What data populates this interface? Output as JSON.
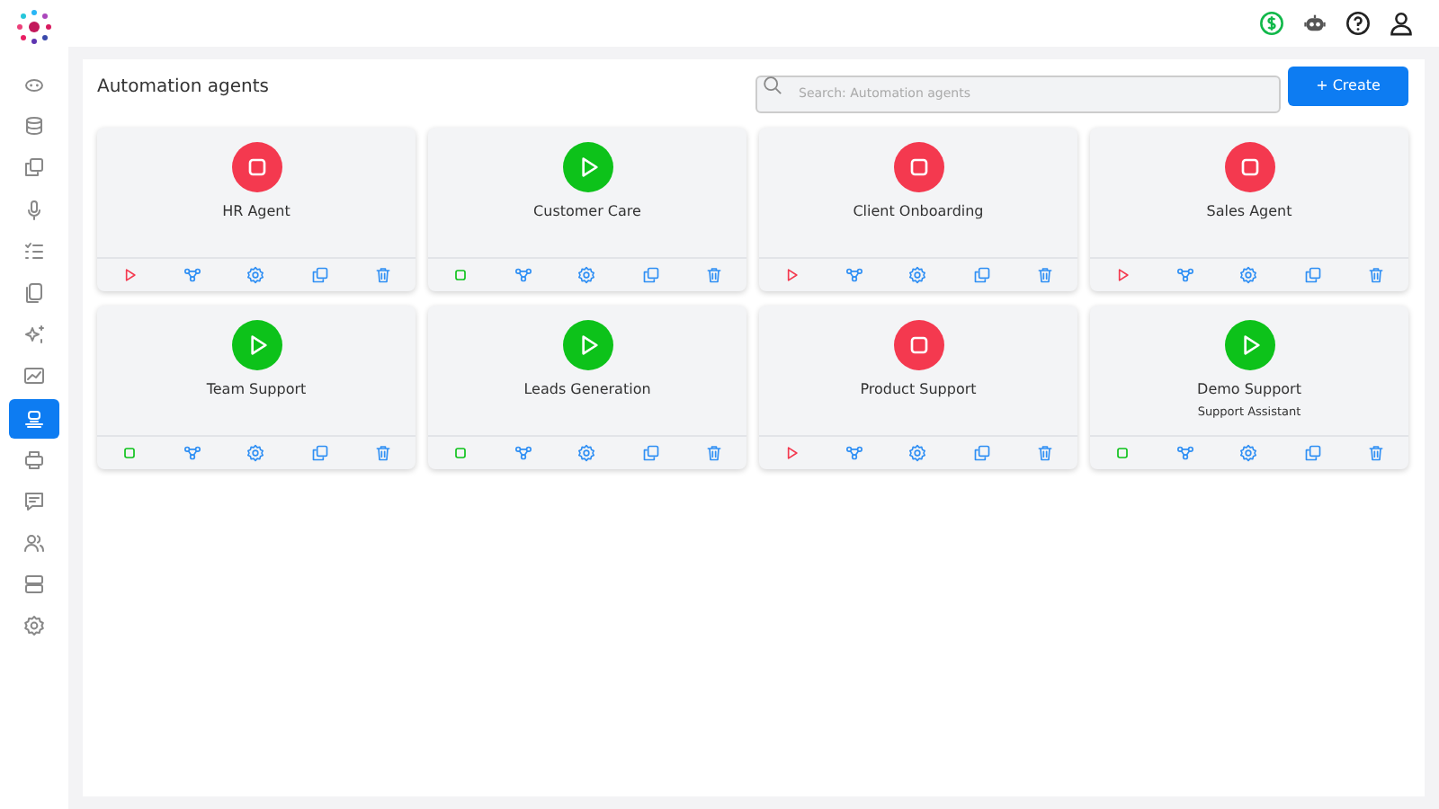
{
  "sidebar": {
    "items": [
      {
        "selected": false
      },
      {
        "selected": false
      },
      {
        "selected": false
      },
      {
        "selected": false
      },
      {
        "selected": false
      },
      {
        "selected": false
      },
      {
        "selected": false
      },
      {
        "selected": false
      },
      {
        "selected": true
      },
      {
        "selected": false
      },
      {
        "selected": false
      },
      {
        "selected": false
      },
      {
        "selected": false
      },
      {
        "selected": false
      }
    ]
  },
  "page": {
    "title": "Automation agents",
    "search": {
      "placeholder": "Search: Automation agents"
    },
    "create_button": "+ Create"
  },
  "agents": [
    {
      "name": "HR Agent",
      "running": false
    },
    {
      "name": "Customer Care",
      "running": true
    },
    {
      "name": "Client Onboarding",
      "running": false
    },
    {
      "name": "Sales Agent",
      "running": false
    },
    {
      "name": "Team Support",
      "running": true
    },
    {
      "name": "Leads Generation",
      "running": true
    },
    {
      "name": "Product Support",
      "running": false
    },
    {
      "name": "Demo Support",
      "subtitle": "Support Assistant",
      "running": true
    }
  ]
}
